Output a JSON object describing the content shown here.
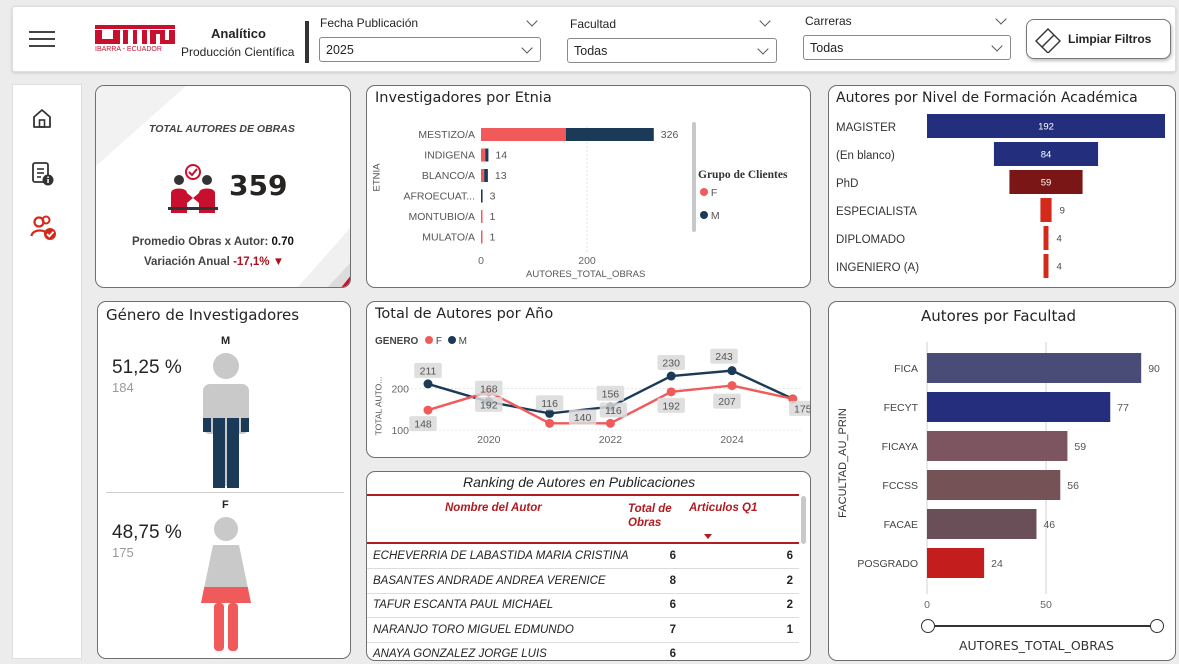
{
  "header": {
    "logo_text": "UTN",
    "logo_sub": "IBARRA - ECUADOR",
    "title": "Analítico",
    "subtitle": "Producción Científica",
    "filters": [
      {
        "label": "Fecha Publicación",
        "value": "2025"
      },
      {
        "label": "Facultad",
        "value": "Todas"
      },
      {
        "label": "Carreras",
        "value": "Todas"
      }
    ],
    "clear_button": "Limpiar Filtros"
  },
  "sidebar": {
    "items": [
      "home-icon",
      "report-info-icon",
      "users-check-icon"
    ]
  },
  "kpi": {
    "title": "TOTAL AUTORES DE OBRAS",
    "value": "359",
    "avg_label": "Promedio Obras x Autor:",
    "avg_value": "0.70",
    "var_label": "Variación Anual",
    "var_value": "-17,1%",
    "var_arrow": "▼"
  },
  "etnia": {
    "title": "Investigadores por Etnia",
    "ylabel": "ETNIA",
    "xlabel": "AUTORES_TOTAL_OBRAS",
    "ticks": [
      "0",
      "200"
    ],
    "legend_title": "Grupo de Clientes",
    "legend": [
      {
        "name": "F",
        "color": "#f05a5a"
      },
      {
        "name": "M",
        "color": "#1b3a57"
      }
    ],
    "rows": [
      {
        "label": "MESTIZO/A",
        "f": 160,
        "m": 166,
        "total": "326"
      },
      {
        "label": "INDIGENA",
        "f": 8,
        "m": 6,
        "total": "14"
      },
      {
        "label": "BLANCO/A",
        "f": 6,
        "m": 7,
        "total": "13"
      },
      {
        "label": "AFROECUAT...",
        "f": 0,
        "m": 3,
        "total": "3"
      },
      {
        "label": "MONTUBIO/A",
        "f": 1,
        "m": 0,
        "total": "1"
      },
      {
        "label": "MULATO/A",
        "f": 1,
        "m": 0,
        "total": "1"
      }
    ]
  },
  "nivel": {
    "title": "Autores por Nivel de Formación Académica",
    "rows": [
      {
        "label": "MAGISTER",
        "value": 192,
        "text": "192",
        "color": "#232e7c"
      },
      {
        "label": "(En blanco)",
        "value": 84,
        "text": "84",
        "color": "#232e7c"
      },
      {
        "label": "PhD",
        "value": 59,
        "text": "59",
        "color": "#7a1616"
      },
      {
        "label": "ESPECIALISTA",
        "value": 9,
        "text": "9",
        "color": "#d42a1c"
      },
      {
        "label": "DIPLOMADO",
        "value": 4,
        "text": "4",
        "color": "#d42a1c"
      },
      {
        "label": "INGENIERO (A)",
        "value": 4,
        "text": "4",
        "color": "#d42a1c"
      }
    ]
  },
  "genero": {
    "title": "Género de Investigadores",
    "m": {
      "letter": "M",
      "pct": "51,25 %",
      "count": "184"
    },
    "f": {
      "letter": "F",
      "pct": "48,75 %",
      "count": "175"
    }
  },
  "anio": {
    "title": "Total de Autores por Año",
    "legend_title": "GENERO",
    "legend": [
      "F",
      "M"
    ],
    "ylabel": "TOTAL AUTO...",
    "yticks": [
      "100",
      "200"
    ],
    "xticks": [
      "2020",
      "2022",
      "2024"
    ]
  },
  "chart_data": {
    "type": "line",
    "x": [
      2019,
      2020,
      2021,
      2022,
      2023,
      2024,
      2025
    ],
    "series": [
      {
        "name": "F",
        "color": "#f05a5a",
        "values": [
          148,
          192,
          116,
          116,
          192,
          207,
          175
        ],
        "labels": [
          "148",
          "192",
          "",
          "",
          "192",
          "207",
          "175"
        ]
      },
      {
        "name": "M",
        "color": "#1b3a57",
        "values": [
          211,
          168,
          140,
          156,
          230,
          243,
          175
        ],
        "labels": [
          "211",
          "168",
          "116",
          "156",
          "230",
          "243",
          ""
        ]
      }
    ],
    "extra_labels": [
      "140",
      "116"
    ]
  },
  "ranking": {
    "title": "Ranking de Autores en Publicaciones",
    "headers": [
      "Nombre del Autor",
      "Total de Obras",
      "Articulos Q1"
    ],
    "rows": [
      [
        "ECHEVERRIA DE LABASTIDA MARIA CRISTINA",
        "6",
        "6"
      ],
      [
        "BASANTES ANDRADE ANDREA VERENICE",
        "8",
        "2"
      ],
      [
        "TAFUR ESCANTA PAUL MICHAEL",
        "6",
        "2"
      ],
      [
        "NARANJO TORO MIGUEL EDMUNDO",
        "7",
        "1"
      ],
      [
        "ANAYA GONZALEZ JORGE LUIS",
        "6",
        ""
      ]
    ]
  },
  "facultad": {
    "title": "Autores por Facultad",
    "ylabel": "FACULTAD_AU_PRIN",
    "xlabel": "AUTORES_TOTAL_OBRAS",
    "ticks": [
      "0",
      "50"
    ],
    "rows": [
      {
        "label": "FICA",
        "value": 90,
        "text": "90",
        "color": "#4a4c78"
      },
      {
        "label": "FECYT",
        "value": 77,
        "text": "77",
        "color": "#252e7c"
      },
      {
        "label": "FICAYA",
        "value": 59,
        "text": "59",
        "color": "#7d5560"
      },
      {
        "label": "FCCSS",
        "value": 56,
        "text": "56",
        "color": "#755256"
      },
      {
        "label": "FACAE",
        "value": 46,
        "text": "46",
        "color": "#6a4e58"
      },
      {
        "label": "POSGRADO",
        "value": 24,
        "text": "24",
        "color": "#c41d1d"
      }
    ]
  }
}
